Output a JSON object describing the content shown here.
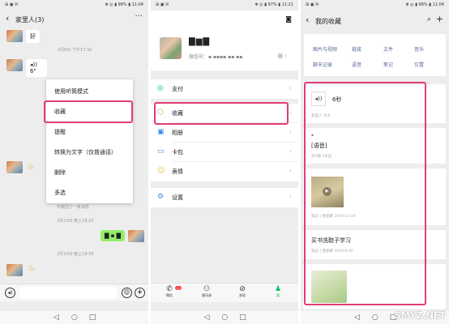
{
  "statusbar": {
    "left": "⊞ ▣ ✉",
    "right_1": "✻ ◎ ▮ 98% ▮ 11:04",
    "right_2": "✻ ◎ ▮ 97% ▮ 11:21",
    "right_3": "✻ ◎ ▮ 98% ▮ 11:04"
  },
  "chat": {
    "title": "家里人(3)",
    "back": "‹",
    "more": "···",
    "msg_hao": "好",
    "ts1": "3月8日 下午17:32",
    "voice_msg": "◂)) 6\"",
    "recalled": "你撤回了一条消息",
    "ts2": "3月10日 晚上18:23",
    "green_msg": "▇ ▪ ▇",
    "ts3": "3月10日 晚上18:30",
    "sticker": "♨",
    "menu": [
      "使用听筒模式",
      "收藏",
      "提醒",
      "转换为文字（仅普通话）",
      "删除",
      "多选"
    ],
    "input_voice": "◂)",
    "input_emoji": "☺",
    "input_plus": "+"
  },
  "me": {
    "camera": "◙",
    "name": "▇▆▇",
    "wxid": "微信号：▪ ▪▪▪▪ ▪▪ ▪▪",
    "qr": "▦ ›",
    "rows": [
      {
        "icon": "◎",
        "label": "支付",
        "color": "#07c160"
      },
      {
        "icon": "⬡",
        "label": "收藏",
        "color": "#e8a33c"
      },
      {
        "icon": "▣",
        "label": "相册",
        "color": "#3f8ee6"
      },
      {
        "icon": "▭",
        "label": "卡包",
        "color": "#3f8ee6"
      },
      {
        "icon": "☺",
        "label": "表情",
        "color": "#e8b93c"
      },
      {
        "icon": "⚙",
        "label": "设置",
        "color": "#3f8ee6"
      }
    ],
    "chev": "›",
    "tabs": [
      {
        "icon": "✆",
        "label": "微信"
      },
      {
        "icon": "⚇",
        "label": "通讯录"
      },
      {
        "icon": "⊘",
        "label": "发现"
      },
      {
        "icon": "♟",
        "label": "我"
      }
    ],
    "badge": "..."
  },
  "favorites": {
    "title": "我的收藏",
    "back": "‹",
    "search": "⌕",
    "add": "+",
    "cats_row1": [
      "图片与视频",
      "链接",
      "文件",
      "音乐"
    ],
    "cats_row2": [
      "聊天记录",
      "语音",
      "笔记",
      "位置"
    ],
    "voice_icon": "◂))",
    "voice_len": "6秒",
    "voice_meta": "家里人  今天",
    "voice2_mark": "▪",
    "voice2_title": "[语音]",
    "voice2_meta": "李X静  3天前",
    "video_play": "▶",
    "video_meta": "笔记  |  惬意聚  2019-11-19",
    "note_title": "买书洗鞋子学习",
    "note_meta": "笔记  |  惬意聚  2019-9-20",
    "watermark": "SMYZ.NET"
  },
  "nav": {
    "back": "◁",
    "home": "○",
    "recent": "□"
  }
}
